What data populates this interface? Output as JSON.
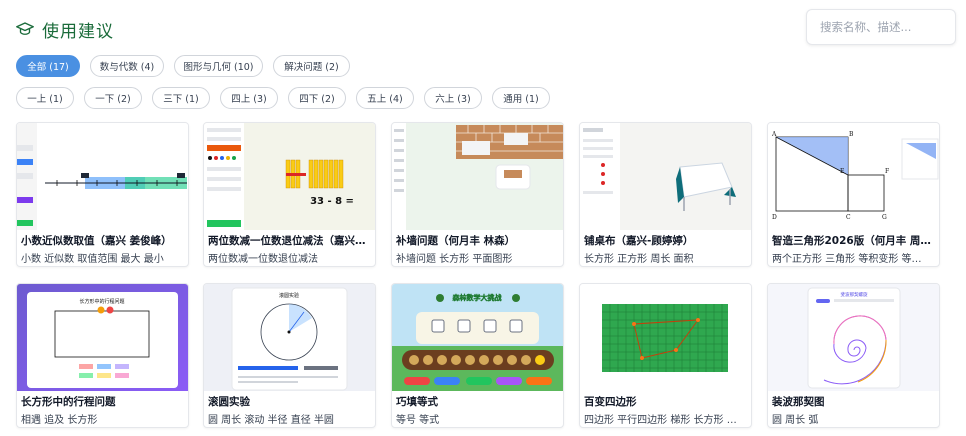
{
  "header": {
    "title": "使用建议",
    "icon": "graduation-cap-icon"
  },
  "search": {
    "placeholder": "搜索名称、描述..."
  },
  "filters": {
    "row1": [
      "全部 (17)",
      "数与代数 (4)",
      "图形与几何 (10)",
      "解决问题 (2)"
    ],
    "row2": [
      "一上 (1)",
      "一下 (2)",
      "三下 (1)",
      "四上 (3)",
      "四下 (2)",
      "五上 (4)",
      "六上 (3)",
      "通用 (1)"
    ],
    "active": "全部 (17)",
    "accent": "#4a90e2"
  },
  "cards": [
    {
      "title": "小数近似数取值（嘉兴 姜俊峰）",
      "tags": "小数 近似数 取值范围 最大 最小"
    },
    {
      "title": "两位数减一位数退位减法（嘉兴…",
      "tags": "两位数减一位数退位减法",
      "thumb_text": "33 - 8 ="
    },
    {
      "title": "补墙问题（何月丰 林森）",
      "tags": "补墙问题 长方形 平面图形"
    },
    {
      "title": "铺桌布（嘉兴-顾婷婷）",
      "tags": "长方形 正方形 周长 面积"
    },
    {
      "title": "智造三角形2026版（何月丰 周…",
      "tags": "两个正方形 三角形 等积变形 等…",
      "thumb_labels": [
        "A",
        "B",
        "E",
        "F",
        "D",
        "C",
        "G"
      ]
    },
    {
      "title": "长方形中的行程问题",
      "tags": "相遇 追及 长方形",
      "thumb_text": "长方形中的行程问题"
    },
    {
      "title": "滚圆实验",
      "tags": "圆 周长 滚动 半径 直径 半圆",
      "thumb_text": "滚圆实验"
    },
    {
      "title": "巧填等式",
      "tags": "等号 等式",
      "thumb_text": "森林数学大挑战"
    },
    {
      "title": "百变四边形",
      "tags": "四边形 平行四边形 梯形 长方形 …"
    },
    {
      "title": "装波那契图",
      "tags": "圆 周长 弧",
      "thumb_text": "斐波那契螺旋"
    }
  ]
}
